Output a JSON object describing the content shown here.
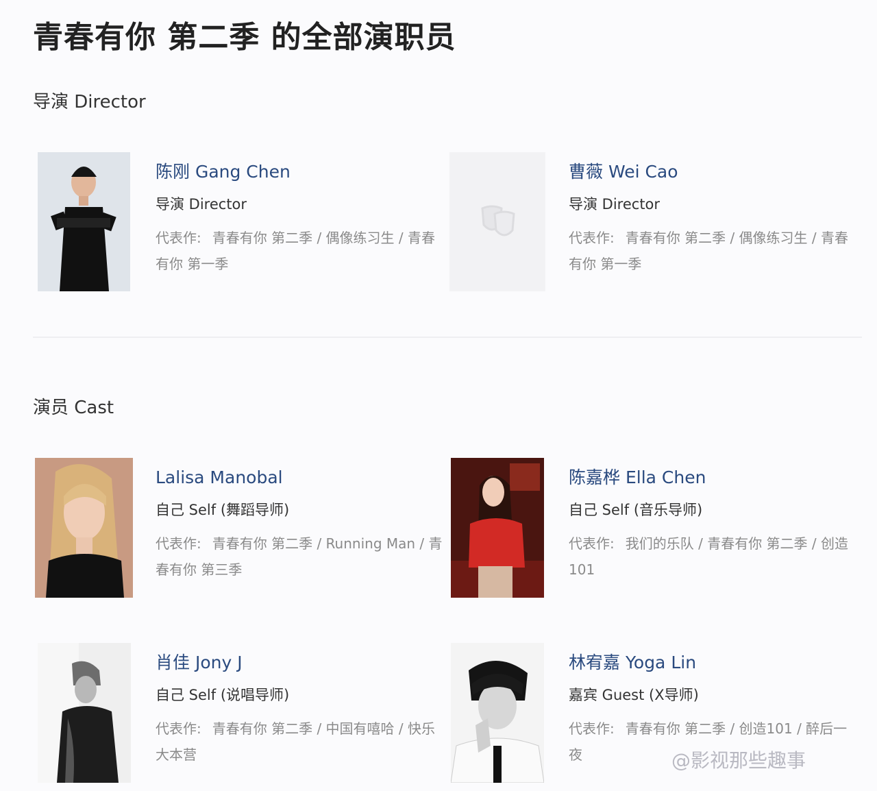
{
  "page": {
    "title": "青春有你 第二季 的全部演职员"
  },
  "sections": {
    "director": {
      "title": "导演 Director"
    },
    "cast": {
      "title": "演员 Cast"
    }
  },
  "works_label": "代表作:",
  "people": [
    {
      "name": "陈刚 Gang Chen",
      "role": "导演 Director",
      "works": "青春有你 第二季 / 偶像练习生 / 青春有你 第一季",
      "photo": "director-photo"
    },
    {
      "name": "曹薇 Wei Cao",
      "role": "导演 Director",
      "works": "青春有你 第二季 / 偶像练习生 / 青春有你 第一季",
      "photo": "placeholder-theater-masks-icon"
    },
    {
      "name": "Lalisa Manobal",
      "role": "自己 Self (舞蹈导师)",
      "works": "青春有你 第二季 / Running Man / 青春有你 第三季",
      "photo": "cast-photo"
    },
    {
      "name": "陈嘉桦 Ella Chen",
      "role": "自己 Self (音乐导师)",
      "works": "我们的乐队 / 青春有你 第二季 / 创造101",
      "photo": "cast-photo"
    },
    {
      "name": "肖佳 Jony J",
      "role": "自己 Self (说唱导师)",
      "works": "青春有你 第二季 / 中国有嘻哈 / 快乐大本营",
      "photo": "cast-photo"
    },
    {
      "name": "林宥嘉 Yoga Lin",
      "role": "嘉宾 Guest (X导师)",
      "works": "青春有你 第二季 / 创造101 / 醉后一夜",
      "photo": "cast-photo"
    }
  ],
  "watermark": "@影视那些趣事",
  "colors": {
    "name_link": "#2a4a7f",
    "muted": "#8a8a8a",
    "background": "#fbfbfd"
  }
}
